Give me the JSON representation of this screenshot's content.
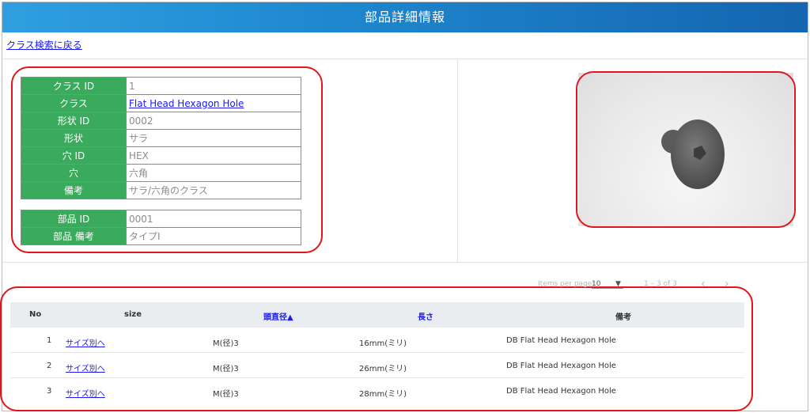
{
  "header": {
    "title": "部品詳細情報"
  },
  "back_link": "クラス検索に戻る",
  "class_info": [
    {
      "label": "クラス ID",
      "value": "1"
    },
    {
      "label": "クラス",
      "value": "Flat Head Hexagon Hole"
    },
    {
      "label": "形状 ID",
      "value": "0002"
    },
    {
      "label": "形状",
      "value": "サラ"
    },
    {
      "label": "穴 ID",
      "value": "HEX"
    },
    {
      "label": "穴",
      "value": "六角"
    },
    {
      "label": "備考",
      "value": "サラ/六角のクラス"
    }
  ],
  "part_info": [
    {
      "label": "部品 ID",
      "value": "0001"
    },
    {
      "label": "部品 備考",
      "value": "タイプI"
    }
  ],
  "pagination": {
    "items_per_page_label": "Items per page:",
    "items_per_page_value": "10",
    "range": "1 – 3 of 3",
    "prev": "‹",
    "next": "›"
  },
  "grid": {
    "columns": [
      "No",
      "size",
      "頭直径▲",
      "長さ",
      "備考"
    ],
    "rows": [
      {
        "no": "1",
        "link": "サイズ別へ",
        "head": "M(径)3",
        "length": "16mm(ミリ)",
        "note": "DB Flat Head Hexagon Hole"
      },
      {
        "no": "2",
        "link": "サイズ別へ",
        "head": "M(径)3",
        "length": "26mm(ミリ)",
        "note": "DB Flat Head Hexagon Hole"
      },
      {
        "no": "3",
        "link": "サイズ別へ",
        "head": "M(径)3",
        "length": "28mm(ミリ)",
        "note": "DB Flat Head Hexagon Hole"
      }
    ]
  },
  "colors": {
    "header": "#1e88cf",
    "label_bg": "#3aab5c",
    "link": "#1a1aee",
    "highlight": "#e0161b"
  }
}
